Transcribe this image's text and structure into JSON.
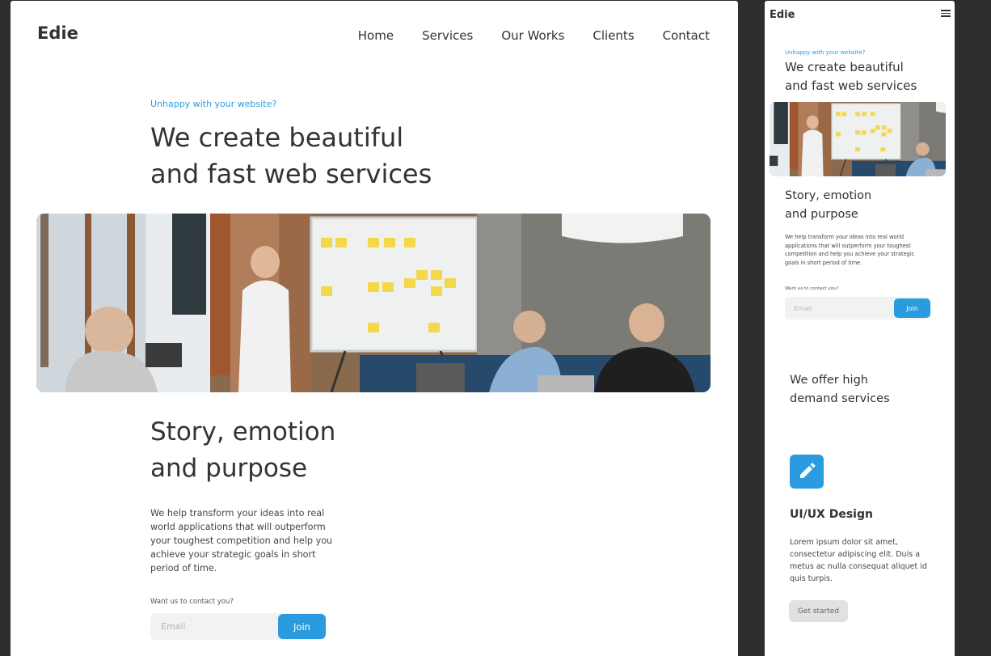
{
  "desktop": {
    "logo": "Edie",
    "nav": [
      "Home",
      "Services",
      "Our Works",
      "Clients",
      "Contact"
    ],
    "hero": {
      "eyebrow": "Unhappy with your website?",
      "title_line1": "We create beautiful",
      "title_line2": "and fast web services"
    },
    "story": {
      "title_line1": "Story, emotion",
      "title_line2": "and purpose",
      "text": "We help transform your ideas into real world applications that will outperform your toughest competition and help you achieve your strategic goals in short period of time."
    },
    "contact": {
      "label": "Want us to contact you?",
      "email_placeholder": "Email",
      "join_label": "Join"
    }
  },
  "mobile": {
    "logo": "Edie",
    "hero": {
      "eyebrow": "Unhappy with your website?",
      "title_line1": "We create beautiful",
      "title_line2": "and fast web services"
    },
    "story": {
      "title_line1": "Story, emotion",
      "title_line2": "and purpose",
      "text": "We help transform your ideas into real world applications that will outperform your toughest competition and help you achieve your strategic goals in short period of time."
    },
    "contact": {
      "label": "Want us to contact you?",
      "email_placeholder": "Email",
      "join_label": "Join"
    },
    "services": {
      "title_line1": "We offer high",
      "title_line2": "demand services",
      "card": {
        "icon": "pencil-icon",
        "title": "UI/UX Design",
        "text": "Lorem ipsum dolor sit amet, consectetur adipiscing elit. Duis a metus ac nulla consequat aliquet id quis turpis.",
        "button_label": "Get started"
      }
    }
  },
  "colors": {
    "accent": "#2b9be0",
    "canvas_background": "#2d2d2d",
    "text": "#333333"
  }
}
